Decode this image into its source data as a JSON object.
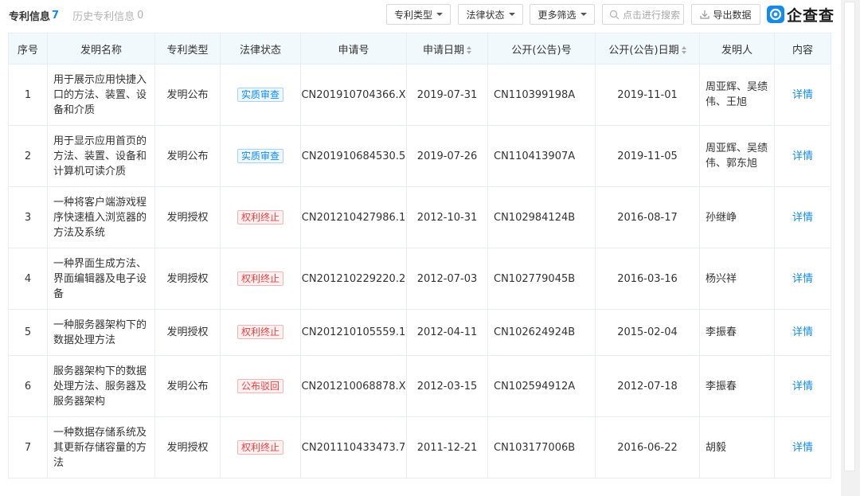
{
  "tabs": {
    "active": {
      "label": "专利信息",
      "count": "7"
    },
    "inactive": {
      "label": "历史专利信息",
      "count": "0"
    }
  },
  "toolbar": {
    "patent_type": "专利类型",
    "legal_status": "法律状态",
    "more_filter": "更多筛选",
    "search_placeholder": "点击进行搜索",
    "export": "导出数据"
  },
  "brand": {
    "logo_text": "企查查",
    "color": "#128bed"
  },
  "colors": {
    "accent": "#128bed",
    "status_review": "#128bed",
    "status_terminated": "#f04040",
    "header_bg": "#f2f9fc"
  },
  "table": {
    "headers": [
      "序号",
      "发明名称",
      "专利类型",
      "法律状态",
      "申请号",
      "申请日期",
      "公开(公告)号",
      "公开(公告)日期",
      "发明人",
      "内容"
    ],
    "rows": [
      {
        "no": "1",
        "name": "用于展示应用快捷入口的方法、装置、设备和介质",
        "type": "发明公布",
        "status": "实质审查",
        "status_kind": "review",
        "app_no": "CN201910704366.X",
        "app_date": "2019-07-31",
        "pub_no": "CN110399198A",
        "pub_date": "2019-11-01",
        "inventor": "周亚辉、吴绩伟、王旭",
        "action": "详情"
      },
      {
        "no": "2",
        "name": "用于显示应用首页的方法、装置、设备和计算机可读介质",
        "type": "发明公布",
        "status": "实质审查",
        "status_kind": "review",
        "app_no": "CN201910684530.5",
        "app_date": "2019-07-26",
        "pub_no": "CN110413907A",
        "pub_date": "2019-11-05",
        "inventor": "周亚辉、吴绩伟、郭东旭",
        "action": "详情"
      },
      {
        "no": "3",
        "name": "一种将客户端游戏程序快速植入浏览器的方法及系统",
        "type": "发明授权",
        "status": "权利终止",
        "status_kind": "terminated",
        "app_no": "CN201210427986.1",
        "app_date": "2012-10-31",
        "pub_no": "CN102984124B",
        "pub_date": "2016-08-17",
        "inventor": "孙继峥",
        "action": "详情"
      },
      {
        "no": "4",
        "name": "一种界面生成方法、界面编辑器及电子设备",
        "type": "发明授权",
        "status": "权利终止",
        "status_kind": "terminated",
        "app_no": "CN201210229220.2",
        "app_date": "2012-07-03",
        "pub_no": "CN102779045B",
        "pub_date": "2016-03-16",
        "inventor": "杨兴祥",
        "action": "详情"
      },
      {
        "no": "5",
        "name": "一种服务器架构下的数据处理方法",
        "type": "发明授权",
        "status": "权利终止",
        "status_kind": "terminated",
        "app_no": "CN201210105559.1",
        "app_date": "2012-04-11",
        "pub_no": "CN102624924B",
        "pub_date": "2015-02-04",
        "inventor": "李振春",
        "action": "详情"
      },
      {
        "no": "6",
        "name": "服务器架构下的数据处理方法、服务器及服务器架构",
        "type": "发明公布",
        "status": "公布驳回",
        "status_kind": "terminated",
        "app_no": "CN201210068878.X",
        "app_date": "2012-03-15",
        "pub_no": "CN102594912A",
        "pub_date": "2012-07-18",
        "inventor": "李振春",
        "action": "详情"
      },
      {
        "no": "7",
        "name": "一种数据存储系统及其更新存储容量的方法",
        "type": "发明授权",
        "status": "权利终止",
        "status_kind": "terminated",
        "app_no": "CN201110433473.7",
        "app_date": "2011-12-21",
        "pub_no": "CN103177006B",
        "pub_date": "2016-06-22",
        "inventor": "胡毅",
        "action": "详情"
      }
    ]
  }
}
